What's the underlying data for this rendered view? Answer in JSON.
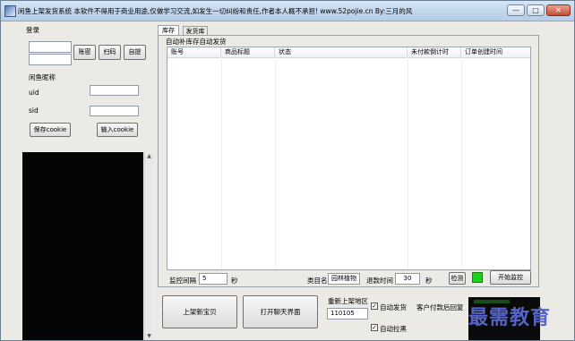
{
  "window": {
    "title": "闲鱼上架发货系统 本软件不得用于商业用途,仅做学习交流,如发生一切纠纷和责任,作者本人概不承担!  www.52pojie.cn  By:三月的风",
    "min_glyph": "—",
    "max_glyph": "□",
    "close_glyph": "✕"
  },
  "login": {
    "section_label": "登录",
    "account_value": "",
    "password_value": "",
    "account_button": "账密",
    "scan_button": "扫码",
    "auto_button": "自提",
    "nickname_label": "闲鱼昵称",
    "uid_label": "uid",
    "uid_value": "",
    "sid_label": "sid",
    "sid_value": "",
    "save_cookie_button": "保存cookie",
    "input_cookie_button": "输入cookie"
  },
  "tabs": [
    {
      "label": "库存"
    },
    {
      "label": "发货库"
    }
  ],
  "inventory": {
    "group_label": "自动补库存自动发货",
    "columns": [
      "账号",
      "商品标题",
      "状态",
      "未付款倒计时",
      "订单创建时间"
    ],
    "rows": [],
    "monitor_interval_label": "监控间隔",
    "monitor_interval_value": "5",
    "seconds_unit": "秒",
    "category_label": "类目名",
    "category_value": "园林植物",
    "refund_time_label": "退款时间",
    "refund_time_value": "30",
    "seconds_unit_2": "秒",
    "detect_button": "检测",
    "start_monitor_button": "开始监控",
    "status_color": "#1fd11f"
  },
  "bottom": {
    "new_item_button": "上架新宝贝",
    "open_chat_button": "打开聊天界面",
    "relist_area_label": "重新上架地区",
    "relist_area_value": "110105",
    "auto_ship_label": "自动发货",
    "auto_ship_checked": true,
    "auto_pull_label": "自动拉黑",
    "auto_pull_checked": true,
    "customer_reply_label": "客户付款后回复"
  },
  "watermark": {
    "text": "最需教育"
  }
}
